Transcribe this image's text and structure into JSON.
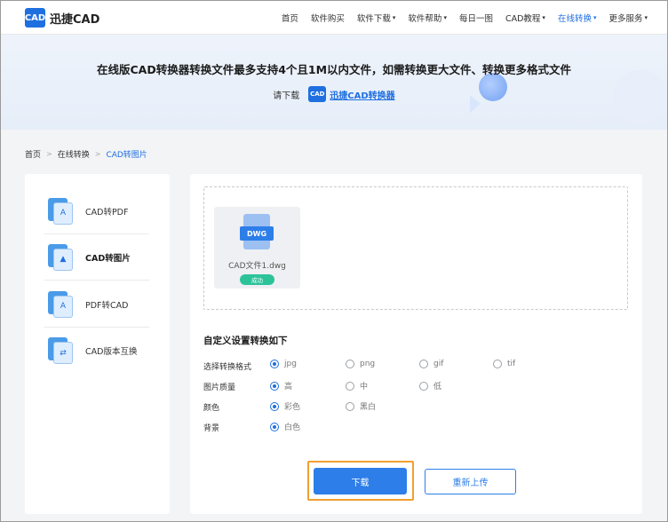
{
  "app": {
    "logo_badge": "CAD",
    "logo_text": "迅捷CAD"
  },
  "nav": {
    "items": [
      {
        "label": "首页",
        "caret": false,
        "active": false
      },
      {
        "label": "软件购买",
        "caret": false,
        "active": false
      },
      {
        "label": "软件下载",
        "caret": true,
        "active": false
      },
      {
        "label": "软件帮助",
        "caret": true,
        "active": false
      },
      {
        "label": "每日一图",
        "caret": false,
        "active": false
      },
      {
        "label": "CAD教程",
        "caret": true,
        "active": false
      },
      {
        "label": "在线转换",
        "caret": true,
        "active": true
      },
      {
        "label": "更多服务",
        "caret": true,
        "active": false
      }
    ],
    "caret_glyph": "▾"
  },
  "banner": {
    "title": "在线版CAD转换器转换文件最多支持4个且1M以内文件，如需转换更大文件、转换更多格式文件",
    "prefix": "请下载",
    "badge": "CAD",
    "link": "迅捷CAD转换器"
  },
  "breadcrumb": {
    "home": "首页",
    "section": "在线转换",
    "current": "CAD转图片",
    "sep": ">"
  },
  "sidebar": {
    "items": [
      {
        "label": "CAD转PDF",
        "icon": "pdf-file-icon",
        "glyph": "A",
        "active": false
      },
      {
        "label": "CAD转图片",
        "icon": "image-file-icon",
        "glyph": "▲",
        "active": true
      },
      {
        "label": "PDF转CAD",
        "icon": "pdf-to-cad-icon",
        "glyph": "A",
        "active": false
      },
      {
        "label": "CAD版本互换",
        "icon": "version-swap-icon",
        "glyph": "⇄",
        "active": false
      }
    ]
  },
  "upload": {
    "file_badge": "DWG",
    "file_name": "CAD文件1.dwg",
    "status": "成功"
  },
  "settings": {
    "title": "自定义设置转换如下",
    "rows": [
      {
        "label": "选择转换格式",
        "options": [
          {
            "label": "jpg",
            "selected": true
          },
          {
            "label": "png",
            "selected": false
          },
          {
            "label": "gif",
            "selected": false
          },
          {
            "label": "tif",
            "selected": false
          }
        ]
      },
      {
        "label": "图片质量",
        "options": [
          {
            "label": "高",
            "selected": true
          },
          {
            "label": "中",
            "selected": false
          },
          {
            "label": "低",
            "selected": false
          }
        ]
      },
      {
        "label": "颜色",
        "options": [
          {
            "label": "彩色",
            "selected": true
          },
          {
            "label": "黑白",
            "selected": false
          }
        ]
      },
      {
        "label": "背景",
        "options": [
          {
            "label": "白色",
            "selected": true
          }
        ]
      }
    ]
  },
  "actions": {
    "download": "下载",
    "reupload": "重新上传"
  },
  "colors": {
    "accent": "#2d7ee8",
    "success": "#2cc39a",
    "highlight": "#f0a030"
  }
}
